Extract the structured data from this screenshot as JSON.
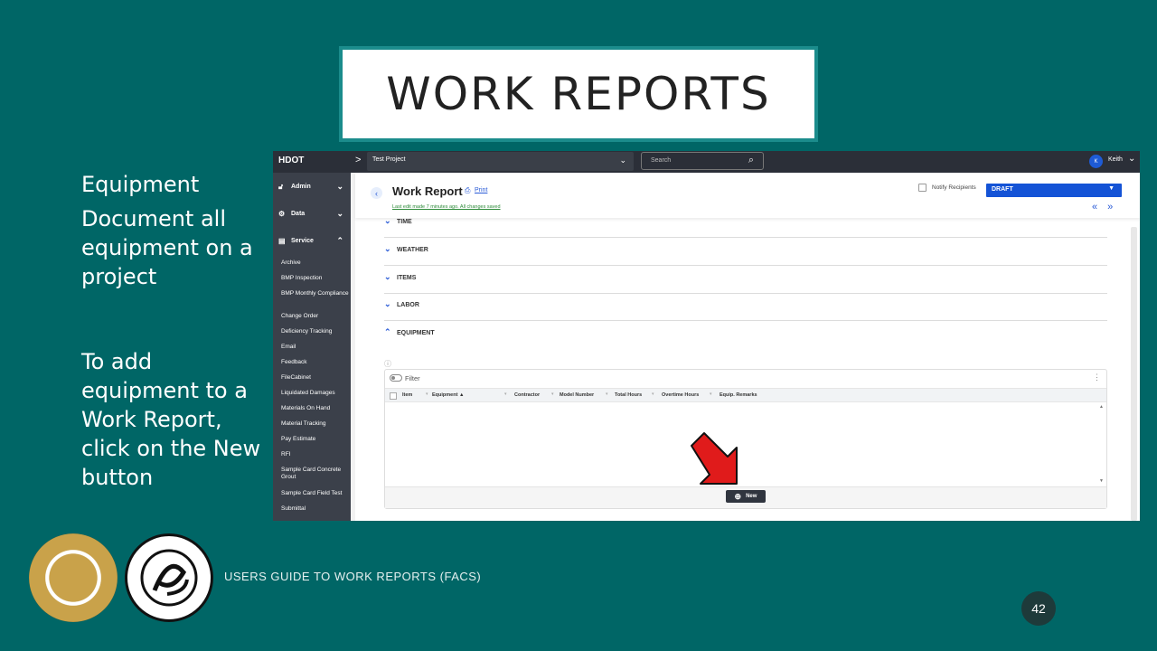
{
  "slide": {
    "title": "WORK REPORTS",
    "heading": "Equipment",
    "description": "Document all equipment on a project",
    "instruction": "To add equipment to a Work Report, click on the New button",
    "footer": "USERS GUIDE TO WORK REPORTS  (FACS)",
    "page_number": "42"
  },
  "app": {
    "brand": "HDOT",
    "project": "Test Project",
    "search_placeholder": "Search",
    "user_initial": "K",
    "user_name": "Keith",
    "sidebar": {
      "sections": [
        {
          "label": "Admin",
          "icon": "lock-icon"
        },
        {
          "label": "Data",
          "icon": "gears-icon"
        },
        {
          "label": "Service",
          "icon": "document-icon"
        }
      ],
      "items": [
        "Archive",
        "BMP Inspection",
        "BMP Monthly Compliance",
        "Change Order",
        "Deficiency Tracking",
        "Email",
        "Feedback",
        "FileCabinet",
        "Liquidated Damages",
        "Materials On Hand",
        "Material Tracking",
        "Pay Estimate",
        "RFI",
        "Sample Card Concrete Grout",
        "Sample Card Field Test",
        "Submittal"
      ]
    },
    "header": {
      "title": "Work Report",
      "print_label": "Print",
      "last_edit": "Last edit made 7 minutes ago. All changes saved",
      "notify_label": "Notify Recipients",
      "status": "DRAFT",
      "pager": "« »"
    },
    "sections": [
      "TIME",
      "WEATHER",
      "ITEMS",
      "LABOR",
      "EQUIPMENT"
    ],
    "grid": {
      "filter_label": "Filter",
      "columns": [
        "Item",
        "Equipment ▲",
        "Contractor",
        "Model Number",
        "Total Hours",
        "Overtime Hours",
        "Equip. Remarks"
      ],
      "new_label": "New"
    }
  },
  "colors": {
    "background": "#006666",
    "accent": "#1453d6",
    "arrow": "#e01b1b"
  }
}
